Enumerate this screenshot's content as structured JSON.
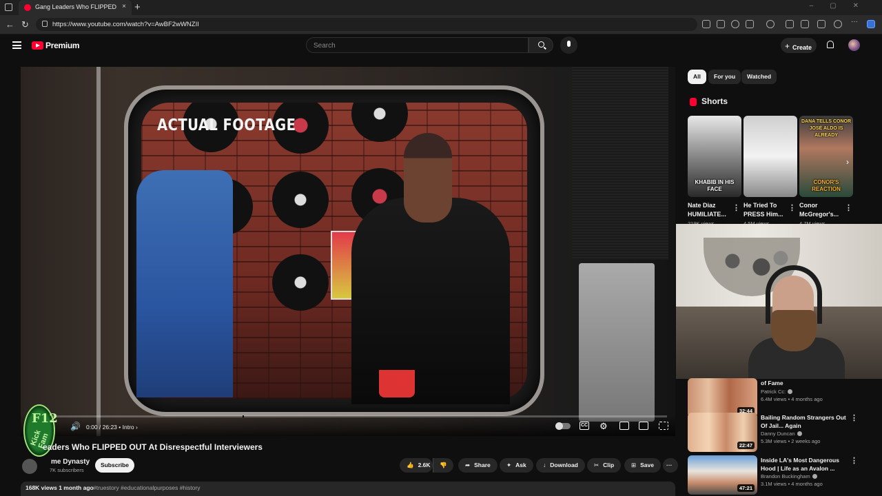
{
  "browser": {
    "tab_title": "Gang Leaders Who FLIPPED OUT",
    "new_tab": "+",
    "close_tab": "×",
    "url": "https://www.youtube.com/watch?v=AwBF2wWNZII"
  },
  "header": {
    "brand": "Premium",
    "search_placeholder": "Search",
    "create_label": "Create",
    "create_plus": "+"
  },
  "player": {
    "overlay_text": "ACTUAL FOOTAGE",
    "time": "0:00 / 26:23",
    "chapter": "• Intro ›",
    "badge_top": "F12",
    "badge_side": "Kick Fam"
  },
  "video": {
    "title": "eaders Who FLIPPED OUT At Disrespectful Interviewers",
    "channel": "me Dynasty",
    "subscribers": "7K subscribers",
    "subscribe_label": "Subscribe",
    "likes": "2.6K",
    "share_label": "Share",
    "ask_label": "Ask",
    "download_label": "Download",
    "clip_label": "Clip",
    "save_label": "Save",
    "stats": "168K views  1 month ago",
    "tags": "#truestory #educationalpurposes #history"
  },
  "sidebar": {
    "chips": [
      "All",
      "For you",
      "Watched"
    ],
    "shorts_heading": "Shorts",
    "shorts": [
      {
        "caption": "KHABIB IN HIS FACE",
        "title": "Nate Diaz HUMILIATE...",
        "views": "219K views"
      },
      {
        "caption": "",
        "title": "He Tried To PRESS Him...",
        "views": "4.5M views"
      },
      {
        "caption": "CONOR'S REACTION",
        "title": "Conor McGregor's...",
        "views": "4.7M views"
      }
    ],
    "short3_top_caption": "DANA TELLS CONOR JOSÉ ALDO IS ALREADY",
    "recommendations": [
      {
        "title": "of Fame",
        "channel": "Patrick Cc:",
        "meta": "6.4M views • 4 months ago",
        "duration": "32:44"
      },
      {
        "title": "Bailing Random Strangers Out Of Jail... Again",
        "channel": "Danny Duncan",
        "meta": "5.3M views • 2 weeks ago",
        "duration": "22:47"
      },
      {
        "title": "Inside LA's Most Dangerous Hood | Life as an Avalon ...",
        "channel": "Brandon Buckingham",
        "meta": "3.1M views • 4 months ago",
        "duration": "47:21"
      }
    ]
  },
  "colors": {
    "youtube_red": "#ff0033",
    "background": "#0f0f0f",
    "chip_bg": "#272727"
  }
}
